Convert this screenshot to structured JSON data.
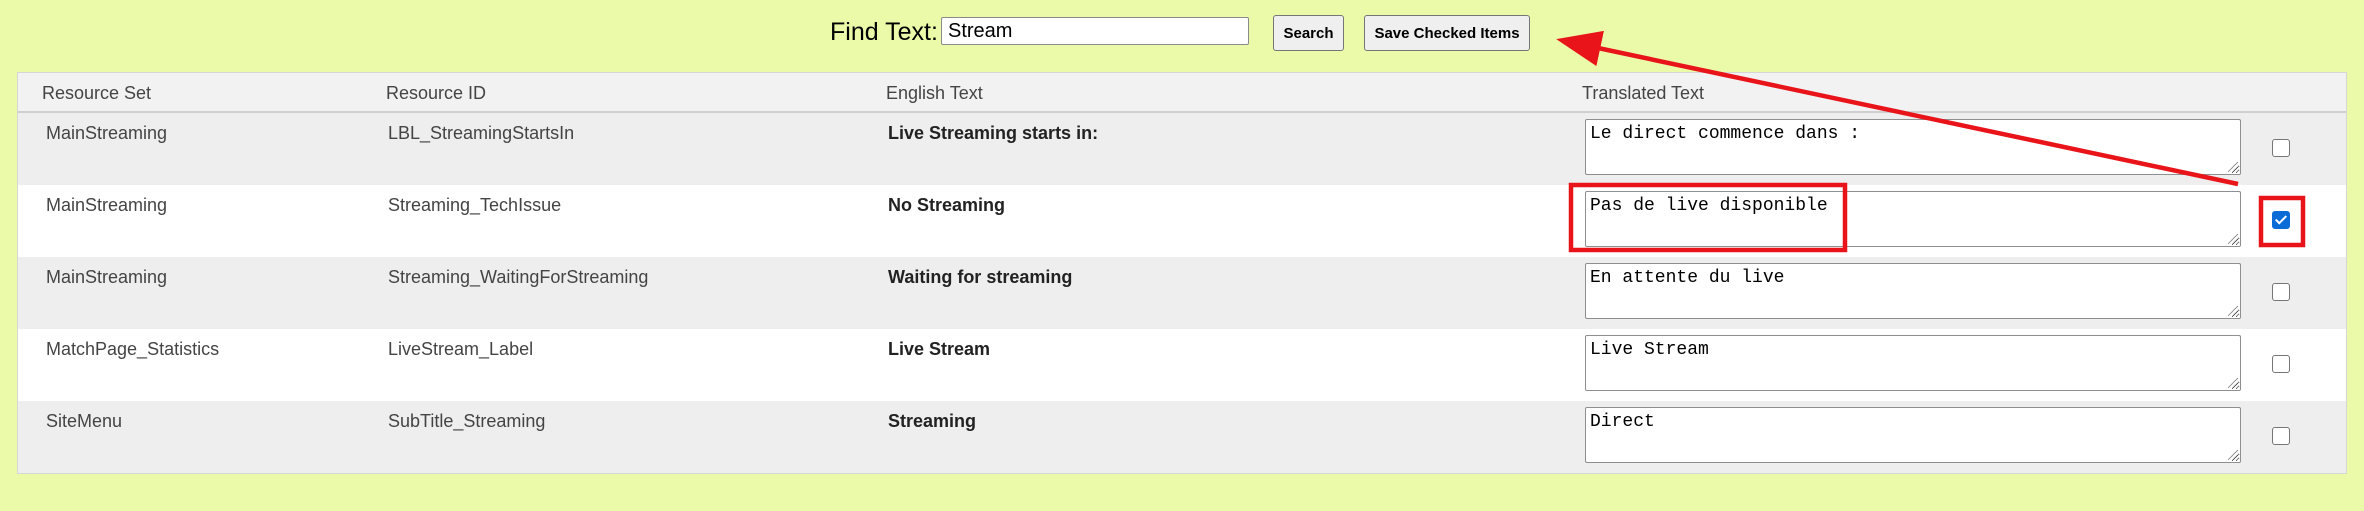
{
  "toolbar": {
    "find_label": "Find Text:",
    "search_value": "Stream",
    "search_button": "Search",
    "save_button": "Save Checked Items"
  },
  "table": {
    "headers": [
      "Resource Set",
      "Resource ID",
      "English Text",
      "Translated Text"
    ],
    "rows": [
      {
        "resource_set": "MainStreaming",
        "resource_id": "LBL_StreamingStartsIn",
        "english": "Live Streaming starts in:",
        "translated": "Le direct commence dans :",
        "checked": false
      },
      {
        "resource_set": "MainStreaming",
        "resource_id": "Streaming_TechIssue",
        "english": "No Streaming",
        "translated": "Pas de live disponible",
        "checked": true
      },
      {
        "resource_set": "MainStreaming",
        "resource_id": "Streaming_WaitingForStreaming",
        "english": "Waiting for streaming",
        "translated": "En attente du live",
        "checked": false
      },
      {
        "resource_set": "MatchPage_Statistics",
        "resource_id": "LiveStream_Label",
        "english": "Live Stream",
        "translated": "Live Stream",
        "checked": false
      },
      {
        "resource_set": "SiteMenu",
        "resource_id": "SubTitle_Streaming",
        "english": "Streaming",
        "translated": "Direct",
        "checked": false
      }
    ]
  },
  "colors": {
    "page_background": "#eafaa9",
    "annotation": "#e8141a",
    "checkbox_checked": "#0b6cd8"
  }
}
